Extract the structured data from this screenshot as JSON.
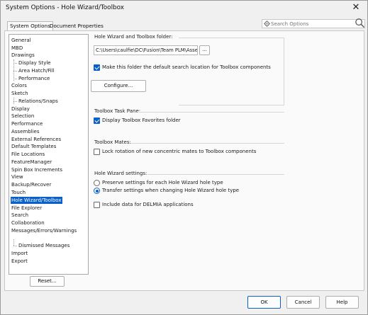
{
  "window": {
    "title": "System Options - Hole Wizard/Toolbox",
    "close_glyph": "✕"
  },
  "search": {
    "placeholder": "Search Options",
    "value": ""
  },
  "tabs": [
    {
      "label": "System Options",
      "active": true
    },
    {
      "label": "Document Properties",
      "active": false
    }
  ],
  "tree": {
    "items": [
      {
        "label": "General"
      },
      {
        "label": "MBD"
      },
      {
        "label": "Drawings"
      },
      {
        "label": "Display Style"
      },
      {
        "label": "Area Hatch/Fill"
      },
      {
        "label": "Performance"
      },
      {
        "label": "Colors"
      },
      {
        "label": "Sketch"
      },
      {
        "label": "Relations/Snaps"
      },
      {
        "label": "Display"
      },
      {
        "label": "Selection"
      },
      {
        "label": "Performance"
      },
      {
        "label": "Assemblies"
      },
      {
        "label": "External References"
      },
      {
        "label": "Default Templates"
      },
      {
        "label": "File Locations"
      },
      {
        "label": "FeatureManager"
      },
      {
        "label": "Spin Box Increments"
      },
      {
        "label": "View"
      },
      {
        "label": "Backup/Recover"
      },
      {
        "label": "Touch"
      },
      {
        "label": "Hole Wizard/Toolbox"
      },
      {
        "label": "File Explorer"
      },
      {
        "label": "Search"
      },
      {
        "label": "Collaboration"
      },
      {
        "label": "Messages/Errors/Warnings"
      },
      {
        "label": "Dismissed Messages"
      },
      {
        "label": "Import"
      },
      {
        "label": "Export"
      }
    ],
    "selected": "Hole Wizard/Toolbox"
  },
  "reset_label": "Reset...",
  "folder_group": {
    "title": "Hole Wizard and Toolbox folder:",
    "path": "C:\\Users\\caulfie\\DC\\Fusion\\Team PLM\\Asset",
    "browse_label": "...",
    "default_location_label": "Make this folder the default search location for Toolbox components",
    "default_location_checked": true,
    "configure_label": "Configure..."
  },
  "task_pane_group": {
    "title": "Toolbox Task Pane:",
    "favorites_label": "Display Toolbox Favorites folder",
    "favorites_checked": true
  },
  "mates_group": {
    "title": "Toolbox Mates:",
    "lock_label": "Lock rotation of new concentric mates to Toolbox components",
    "lock_checked": false
  },
  "hole_wizard_group": {
    "title": "Hole Wizard settings:",
    "preserve_label": "Preserve settings for each Hole Wizard hole type",
    "transfer_label": "Transfer settings when changing Hole Wizard hole type",
    "selected": "transfer"
  },
  "delmia": {
    "label": "Include data for DELMIA applications",
    "checked": false
  },
  "footer": {
    "ok_label": "OK",
    "cancel_label": "Cancel",
    "help_label": "Help"
  },
  "colors": {
    "accent": "#0a60c8",
    "background": "#f0f0f0"
  }
}
